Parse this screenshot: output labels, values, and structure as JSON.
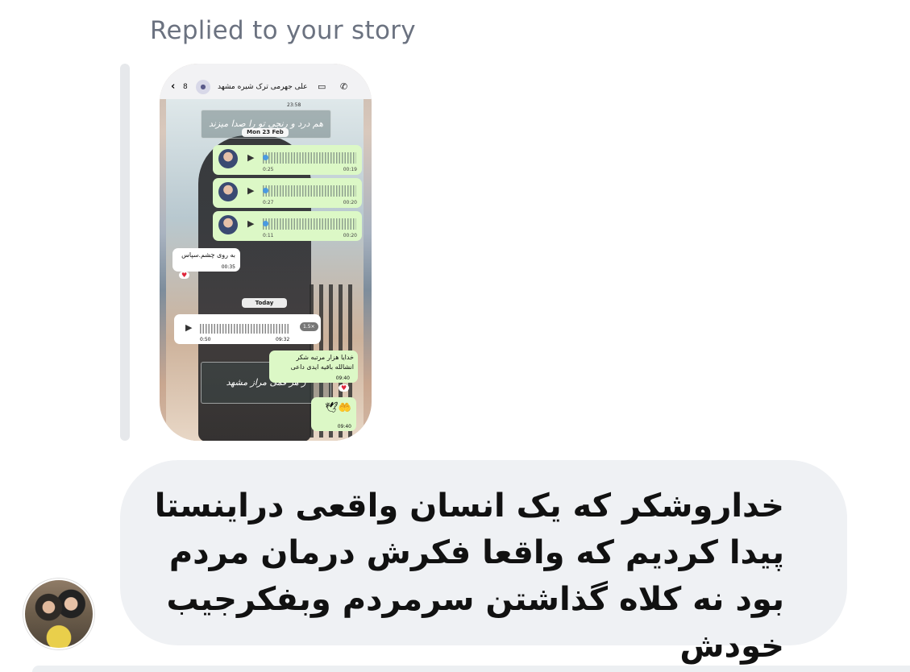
{
  "reply_context": {
    "label": "Replied to your story"
  },
  "story": {
    "chat_header": {
      "back_icon": "chevron-left-icon",
      "unread_count": "8",
      "contact_name": "علی جهرمی ترک شیره مشهد",
      "video_icon": "video-camera-icon",
      "call_icon": "phone-icon"
    },
    "top_timestamp": "23:58",
    "calligraphy_top": "هم درد و رنجی تو را صدا میزند",
    "day_pill": "Mon 23 Feb",
    "voice_messages": [
      {
        "duration": "0:25",
        "time": "00:19"
      },
      {
        "duration": "0:27",
        "time": "00:20"
      },
      {
        "duration": "0:11",
        "time": "00:20"
      }
    ],
    "incoming_text": "به روی چشم.سپاس",
    "incoming_time": "00:35",
    "today_pill": "Today",
    "incoming_voice": {
      "duration": "0:50",
      "time": "09:32",
      "speed": "1.5×"
    },
    "outgoing_text_line1": "خدایا هزار مرتبه شکر",
    "outgoing_text_line2": "انشالله باقیه ایدی داعی",
    "outgoing_time": "09:40",
    "calligraphy_bottom": "ز هر قمی مراز مشهد",
    "outgoing_emoji": "🤲🕊",
    "outgoing_emoji_time": "09:40"
  },
  "message": {
    "text": "خداروشکر که یک انسان واقعی دراینستا پیدا کردیم که واقعا فکرش درمان مردم بود نه کلاه گذاشتن سرمردم وبفکرجیب خودش"
  }
}
